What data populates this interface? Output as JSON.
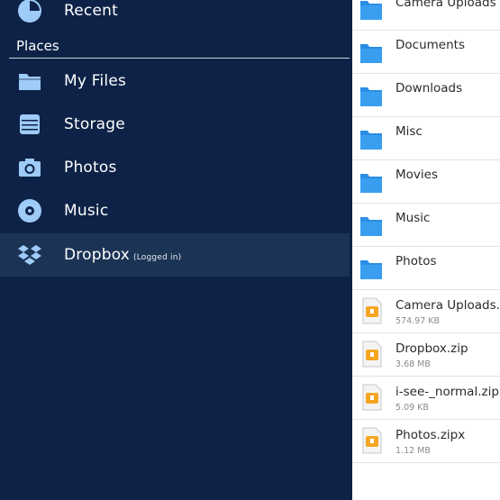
{
  "sidebar": {
    "recent_label": "Recent",
    "places_header": "Places",
    "items": [
      {
        "label": "My Files",
        "icon": "folder-icon"
      },
      {
        "label": "Storage",
        "icon": "storage-icon"
      },
      {
        "label": "Photos",
        "icon": "camera-icon"
      },
      {
        "label": "Music",
        "icon": "music-disc-icon"
      },
      {
        "label": "Dropbox",
        "sub": "(Logged in)",
        "icon": "dropbox-icon"
      }
    ]
  },
  "files": {
    "folders": [
      "Camera Uploads",
      "Documents",
      "Downloads",
      "Misc",
      "Movies",
      "Music",
      "Photos"
    ],
    "zips": [
      {
        "name": "Camera Uploads.",
        "size": "574.97 KB"
      },
      {
        "name": "Dropbox.zip",
        "size": "3.68 MB"
      },
      {
        "name": "i-see-_normal.zip",
        "size": "5.09 KB"
      },
      {
        "name": "Photos.zipx",
        "size": "1.12 MB"
      }
    ]
  },
  "colors": {
    "sidebar_bg": "#0d2246",
    "active_bg": "#1b3355",
    "icon_blue": "#9ecbf7",
    "folder_blue": "#2a8ee6",
    "zip_orange": "#f5a623"
  }
}
